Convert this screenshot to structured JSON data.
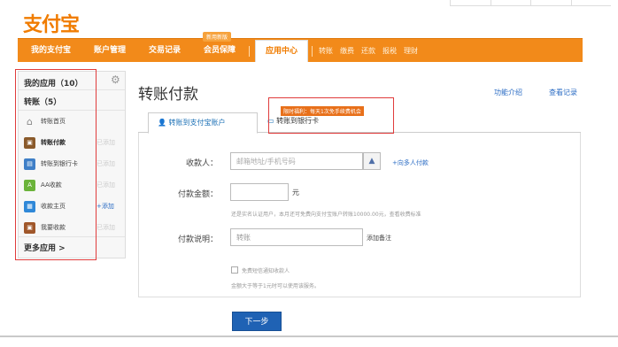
{
  "logo": {
    "text": "支付宝"
  },
  "nav": {
    "items": [
      "我的支付宝",
      "账户管理",
      "交易记录",
      "会员保障"
    ],
    "badge": "新用新版",
    "active": "应用中心",
    "sub": [
      "转账",
      "缴费",
      "还款",
      "报税",
      "理财"
    ]
  },
  "sidebar": {
    "title": "我的应用（10）",
    "group": "转账（5）",
    "items": [
      {
        "label": "转账首页",
        "action": ""
      },
      {
        "label": "转账付款",
        "action": "已添加"
      },
      {
        "label": "转账到银行卡",
        "action": "已添加"
      },
      {
        "label": "AA收款",
        "action": "已添加"
      },
      {
        "label": "收款主页",
        "action": "+添加"
      },
      {
        "label": "我要收款",
        "action": "已添加"
      }
    ],
    "more": "更多应用 >"
  },
  "main": {
    "title": "转账付款",
    "link_intro": "功能介绍",
    "link_records": "查看记录",
    "tabs": [
      "转账到支付宝账户",
      "转账到银行卡"
    ],
    "promo": "限时福利：每天1次免手续费机会"
  },
  "form": {
    "payee_label": "收款人：",
    "payee_placeholder": "邮箱地址/手机号码",
    "multi_link": "+向多人付款",
    "amount_label": "付款金额：",
    "amount_unit": "元",
    "amount_note": "还是实名认证用户，本月还可免费向支付宝账户转账10000.00元，查看收费标准",
    "memo_label": "付款说明：",
    "memo_value": "转账",
    "memo_link": "添加备注",
    "check_label": "免费短信通知收款人",
    "check_note": "金额大于等于1元时可以使用该服务。",
    "submit": "下一步"
  }
}
